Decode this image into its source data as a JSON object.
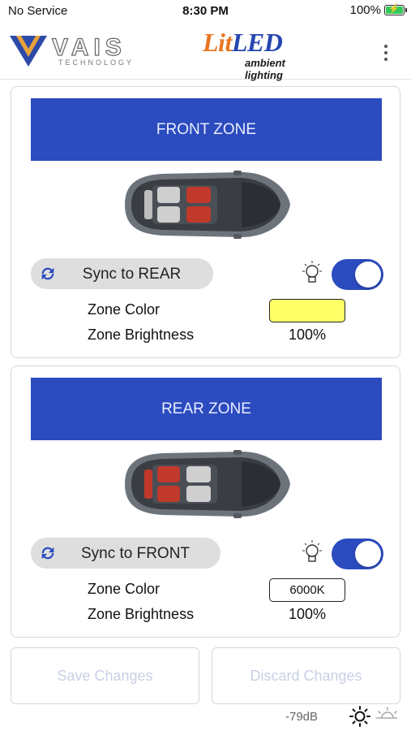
{
  "status_bar": {
    "carrier": "No Service",
    "time": "8:30 PM",
    "battery_percent": "100%",
    "battery_level": 1.0
  },
  "header": {
    "vais_logo_text": "VAIS",
    "vais_logo_subtext": "TECHNOLOGY",
    "litled_lit": "Lit",
    "litled_led": "LED",
    "litled_subtitle": "ambient lighting",
    "more_icon": "more-vertical-icon"
  },
  "zones": [
    {
      "title": "FRONT ZONE",
      "sync_label": "Sync to REAR",
      "enabled": true,
      "color_label": "Zone Color",
      "color_value": "",
      "color_hex": "#ffff66",
      "brightness_label": "Zone Brightness",
      "brightness_value": "100%",
      "highlighted_seats": "front"
    },
    {
      "title": "REAR ZONE",
      "sync_label": "Sync to FRONT",
      "enabled": true,
      "color_label": "Zone Color",
      "color_value": "6000K",
      "color_hex": "#ffffff",
      "brightness_label": "Zone Brightness",
      "brightness_value": "100%",
      "highlighted_seats": "rear"
    }
  ],
  "actions": {
    "save_label": "Save Changes",
    "discard_label": "Discard Changes",
    "enabled": false
  },
  "footer": {
    "signal": "-79dB",
    "light_on_icon": "sun-icon",
    "light_off_icon": "sun-dim-icon"
  },
  "colors": {
    "accent": "#2b4bbf",
    "seat_highlight": "#c0392b",
    "disabled_text": "#c9d0e6"
  }
}
